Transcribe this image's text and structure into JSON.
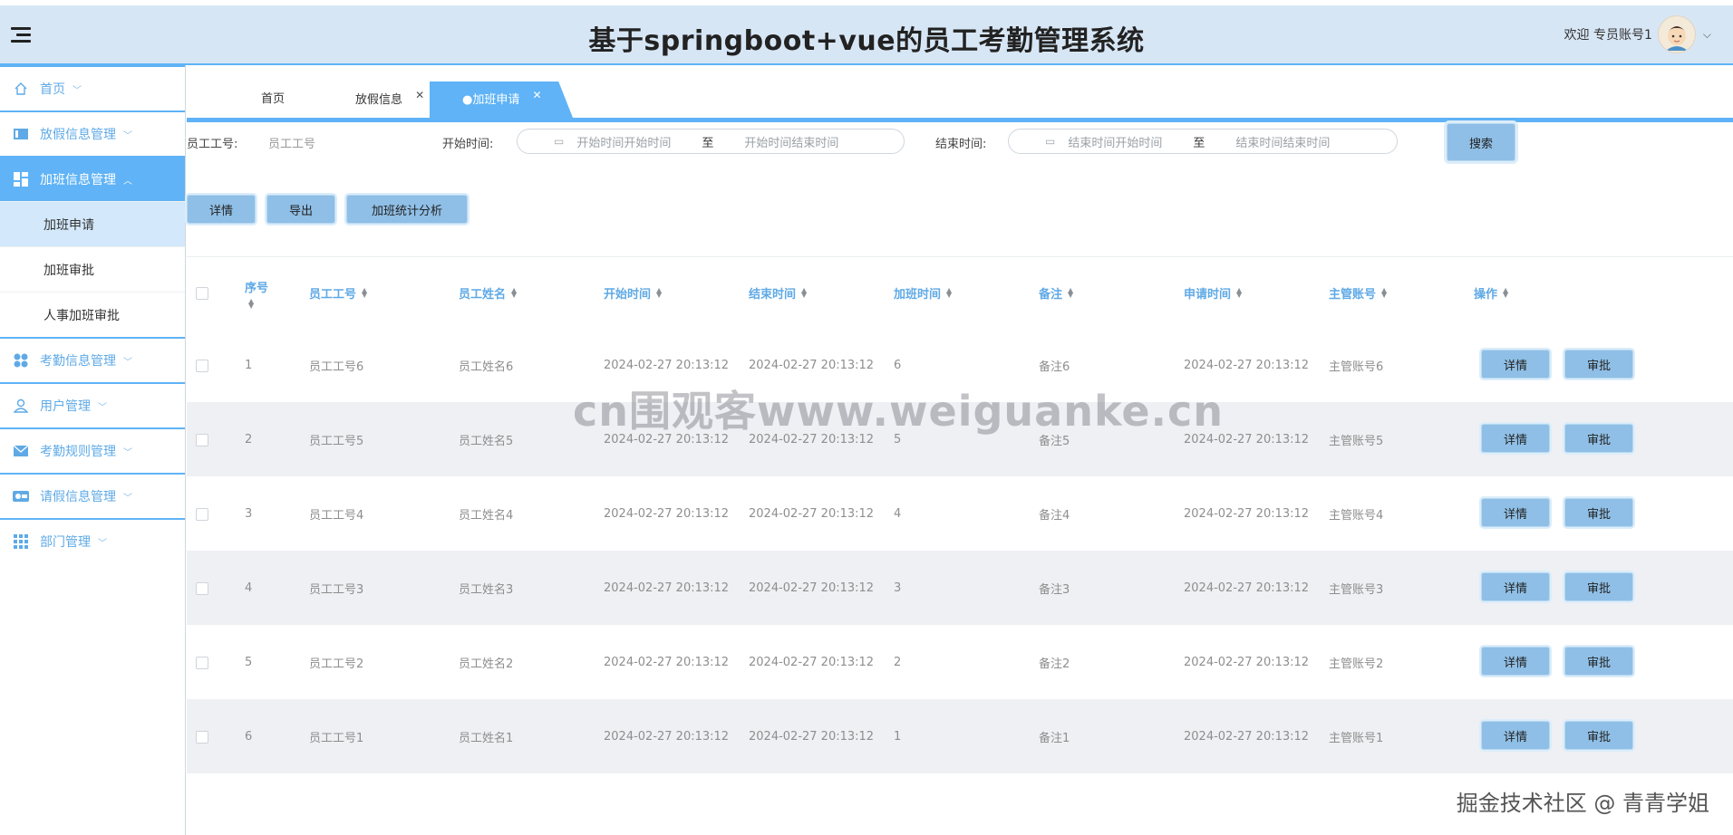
{
  "header": {
    "title": "基于springboot+vue的员工考勤管理系统",
    "welcome": "欢迎 专员账号1"
  },
  "sidebar": {
    "items": [
      {
        "label": "首页",
        "icon": "home-icon"
      },
      {
        "label": "放假信息管理",
        "icon": "card-icon"
      },
      {
        "label": "加班信息管理",
        "icon": "dashboard-icon",
        "expanded": true,
        "children": [
          {
            "label": "加班申请",
            "active": true
          },
          {
            "label": "加班审批"
          },
          {
            "label": "人事加班审批"
          }
        ]
      },
      {
        "label": "考勤信息管理",
        "icon": "dots-icon"
      },
      {
        "label": "用户管理",
        "icon": "user-icon"
      },
      {
        "label": "考勤规则管理",
        "icon": "mail-icon"
      },
      {
        "label": "请假信息管理",
        "icon": "toggle-icon"
      },
      {
        "label": "部门管理",
        "icon": "grid-icon"
      }
    ]
  },
  "tabs": [
    {
      "label": "首页",
      "closable": false,
      "active": false
    },
    {
      "label": "放假信息",
      "closable": true,
      "active": false
    },
    {
      "label": "●加班申请",
      "closable": true,
      "active": true
    }
  ],
  "search": {
    "emp_no_label": "员工工号:",
    "emp_no_placeholder": "员工工号",
    "start_label": "开始时间:",
    "start_from": "开始时间开始时间",
    "start_to": "开始时间结束时间",
    "end_label": "结束时间:",
    "end_from": "结束时间开始时间",
    "end_to": "结束时间结束时间",
    "range_sep": "至",
    "button": "搜索"
  },
  "actions": {
    "detail": "详情",
    "export": "导出",
    "stats": "加班统计分析"
  },
  "table": {
    "columns": [
      "序号",
      "员工工号",
      "员工姓名",
      "开始时间",
      "结束时间",
      "加班时间",
      "备注",
      "申请时间",
      "主管账号",
      "操作"
    ],
    "rows": [
      {
        "no": "1",
        "emp_no": "员工工号6",
        "name": "员工姓名6",
        "start": "2024-02-27 20:13:12",
        "end": "2024-02-27 20:13:12",
        "hours": "6",
        "remark": "备注6",
        "applied": "2024-02-27 20:13:12",
        "manager": "主管账号6"
      },
      {
        "no": "2",
        "emp_no": "员工工号5",
        "name": "员工姓名5",
        "start": "2024-02-27 20:13:12",
        "end": "2024-02-27 20:13:12",
        "hours": "5",
        "remark": "备注5",
        "applied": "2024-02-27 20:13:12",
        "manager": "主管账号5"
      },
      {
        "no": "3",
        "emp_no": "员工工号4",
        "name": "员工姓名4",
        "start": "2024-02-27 20:13:12",
        "end": "2024-02-27 20:13:12",
        "hours": "4",
        "remark": "备注4",
        "applied": "2024-02-27 20:13:12",
        "manager": "主管账号4"
      },
      {
        "no": "4",
        "emp_no": "员工工号3",
        "name": "员工姓名3",
        "start": "2024-02-27 20:13:12",
        "end": "2024-02-27 20:13:12",
        "hours": "3",
        "remark": "备注3",
        "applied": "2024-02-27 20:13:12",
        "manager": "主管账号3"
      },
      {
        "no": "5",
        "emp_no": "员工工号2",
        "name": "员工姓名2",
        "start": "2024-02-27 20:13:12",
        "end": "2024-02-27 20:13:12",
        "hours": "2",
        "remark": "备注2",
        "applied": "2024-02-27 20:13:12",
        "manager": "主管账号2"
      },
      {
        "no": "6",
        "emp_no": "员工工号1",
        "name": "员工姓名1",
        "start": "2024-02-27 20:13:12",
        "end": "2024-02-27 20:13:12",
        "hours": "1",
        "remark": "备注1",
        "applied": "2024-02-27 20:13:12",
        "manager": "主管账号1"
      }
    ],
    "row_actions": {
      "detail": "详情",
      "approve": "审批"
    }
  },
  "watermarks": {
    "center": "cn围观客www.weiguanke.cn",
    "bottom": "掘金技术社区 @ 青青学姐"
  },
  "colors": {
    "accent": "#5fb3f6",
    "header_bg": "#d7e6f5",
    "button_bg": "#8fbfe6",
    "alt_row": "#eef0f3"
  }
}
